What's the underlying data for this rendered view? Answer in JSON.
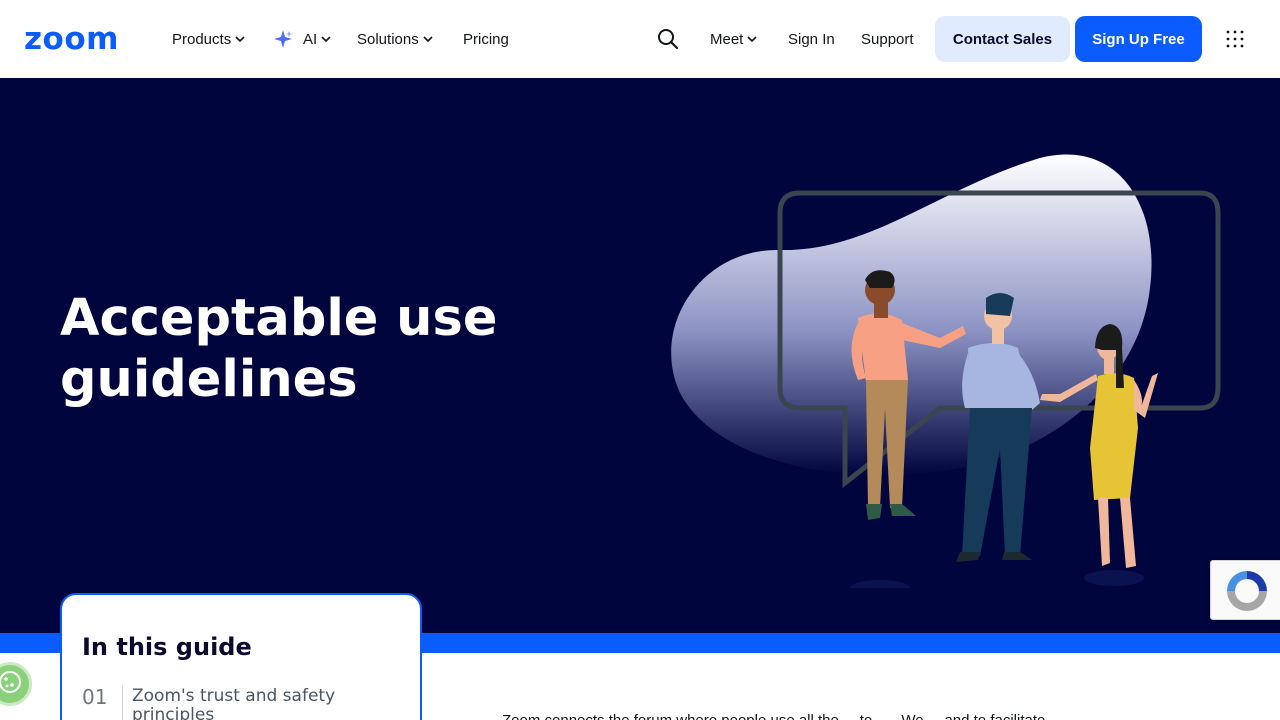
{
  "brand": {
    "logo_text": "zoom",
    "accent": "#0b5cff",
    "hero_bg": "#00053d"
  },
  "nav": {
    "products": "Products",
    "ai": "AI",
    "solutions": "Solutions",
    "pricing": "Pricing",
    "meet": "Meet",
    "sign_in": "Sign In",
    "support": "Support",
    "contact_sales": "Contact Sales",
    "sign_up": "Sign Up Free"
  },
  "hero": {
    "title_line1": "Acceptable use",
    "title_line2": "guidelines",
    "illustration": "people-talking-speech-bubble-illustration"
  },
  "guide": {
    "title": "In this guide",
    "items": [
      {
        "number": "01",
        "label": "Zoom's trust and safety principles"
      }
    ]
  },
  "body": {
    "intro_partial": "Zoom connects the forum where people use all the ... to ..... We ... and to facilitate"
  },
  "icons": {
    "search": "search-icon",
    "apps": "apps-grid-icon",
    "cookie": "cookie-icon",
    "recaptcha": "recaptcha-icon",
    "sparkle": "ai-sparkle-icon"
  }
}
